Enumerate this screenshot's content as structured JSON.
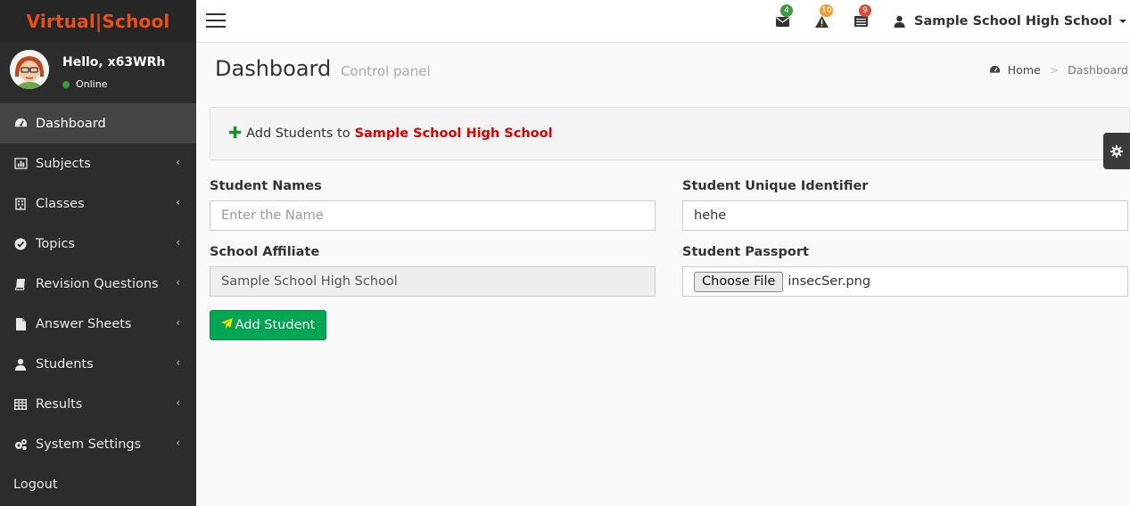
{
  "brand": {
    "logo_text": "Virtual|School"
  },
  "user": {
    "greeting": "Hello, x63WRh",
    "status": "Online"
  },
  "sidebar": {
    "items": [
      {
        "label": "Dashboard",
        "icon": "dashboard-icon",
        "active": true
      },
      {
        "label": "Subjects",
        "icon": "bar-chart-icon"
      },
      {
        "label": "Classes",
        "icon": "building-icon"
      },
      {
        "label": "Topics",
        "icon": "check-circle-icon"
      },
      {
        "label": "Revision Questions",
        "icon": "book-icon"
      },
      {
        "label": "Answer Sheets",
        "icon": "file-icon"
      },
      {
        "label": "Students",
        "icon": "user-icon"
      },
      {
        "label": "Results",
        "icon": "table-icon"
      },
      {
        "label": "System Settings",
        "icon": "gears-icon"
      },
      {
        "label": "Logout",
        "icon": ""
      }
    ]
  },
  "topbar": {
    "messages_count": "4",
    "alerts_count": "10",
    "tasks_count": "9",
    "school_name": "Sample School High School"
  },
  "header": {
    "title": "Dashboard",
    "subtitle": "Control panel",
    "breadcrumb_home": "Home",
    "breadcrumb_sep": ">",
    "breadcrumb_current": "Dashboard"
  },
  "callout": {
    "prefix": "Add Students to",
    "school": "Sample School High School"
  },
  "form": {
    "names_label": "Student Names",
    "names_placeholder": "Enter the Name",
    "uid_label": "Student Unique Identifier",
    "uid_value": "hehe",
    "affiliate_label": "School Affiliate",
    "affiliate_value": "Sample School High School",
    "passport_label": "Student Passport",
    "choose_file_label": "Choose File",
    "file_name": "insecSer.png",
    "submit_label": "Add Student"
  },
  "colors": {
    "brand": "#e8501a",
    "sidebar_bg": "#2c2c2c",
    "submit_green": "#00a651",
    "school_red": "#dd0000",
    "badge_green": "#3c9a3c",
    "badge_orange": "#f0a030",
    "badge_red": "#dd4b39"
  }
}
